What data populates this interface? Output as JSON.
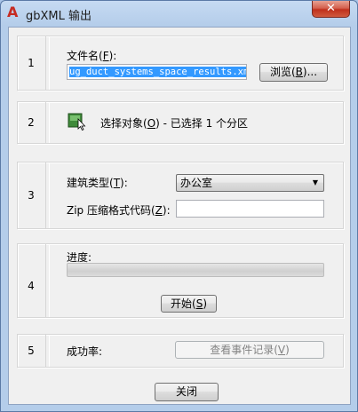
{
  "window": {
    "title": "gbXML 输出",
    "app_icon_glyph": "A",
    "close_glyph": "✕"
  },
  "panels": {
    "file": {
      "number": "1",
      "label": "文件名(",
      "hotkey": "F",
      "label_end": "):",
      "path_value": "ug_duct_systems_space_results.xml",
      "browse_label": "浏览(",
      "browse_hotkey": "B",
      "browse_end": ")..."
    },
    "select": {
      "number": "2",
      "icon": "select-objects-icon",
      "text": "选择对象(",
      "hotkey": "O",
      "text_end": ") - 已选择 1 个分区"
    },
    "building": {
      "number": "3",
      "type_label": "建筑类型(",
      "type_hotkey": "T",
      "type_end": "):",
      "type_value": "办公室",
      "zip_label": "Zip 压缩格式代码(",
      "zip_hotkey": "Z",
      "zip_end": "):",
      "zip_value": ""
    },
    "progress": {
      "number": "4",
      "label": "进度:",
      "value_fraction": 0,
      "start_label": "开始(",
      "start_hotkey": "S",
      "start_end": ")"
    },
    "success": {
      "number": "5",
      "label": "成功率:",
      "log_label": "查看事件记录(",
      "log_hotkey": "V",
      "log_end": ")"
    }
  },
  "close_button": {
    "label": "关闭"
  },
  "colors": {
    "title_bar": "#c6daf2",
    "close_red": "#c0301c",
    "selection": "#3399ff",
    "progress_fill": "#06b025"
  }
}
